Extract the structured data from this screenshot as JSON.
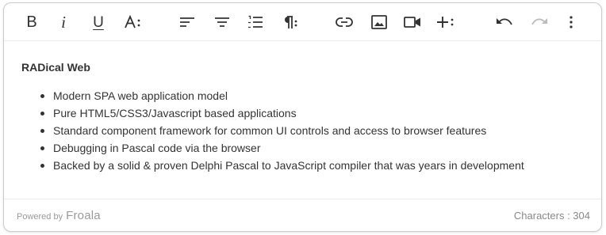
{
  "toolbar": {
    "icons": {
      "bold": "bold-icon",
      "italic": "italic-icon",
      "underline": "underline-icon",
      "text_style": "text-format-icon",
      "align": "align-left-icon",
      "center": "align-center-icon",
      "list": "ordered-list-icon",
      "paragraph": "paragraph-format-icon",
      "link": "link-icon",
      "image": "image-icon",
      "video": "video-icon",
      "insert_more": "insert-more-icon",
      "undo": "undo-icon",
      "redo": "redo-icon",
      "more": "more-vertical-icon"
    },
    "glyphs": {
      "bold": "B",
      "italic": "i",
      "underline": "U"
    }
  },
  "content": {
    "heading": "RADical Web",
    "items": [
      "Modern SPA web application model",
      "Pure HTML5/CSS3/Javascript based applications",
      "Standard component framework for common UI controls and access to browser features",
      "Debugging in Pascal code via the browser",
      "Backed by a solid & proven Delphi Pascal to JavaScript compiler that was years in development"
    ]
  },
  "footer": {
    "powered_by": "Powered by",
    "brand": "Froala",
    "character_count": "Characters : 304"
  },
  "colors": {
    "icon": "#333333",
    "disabled_icon": "#bbbbbb",
    "border": "#cccccc",
    "muted_text": "#888888"
  }
}
